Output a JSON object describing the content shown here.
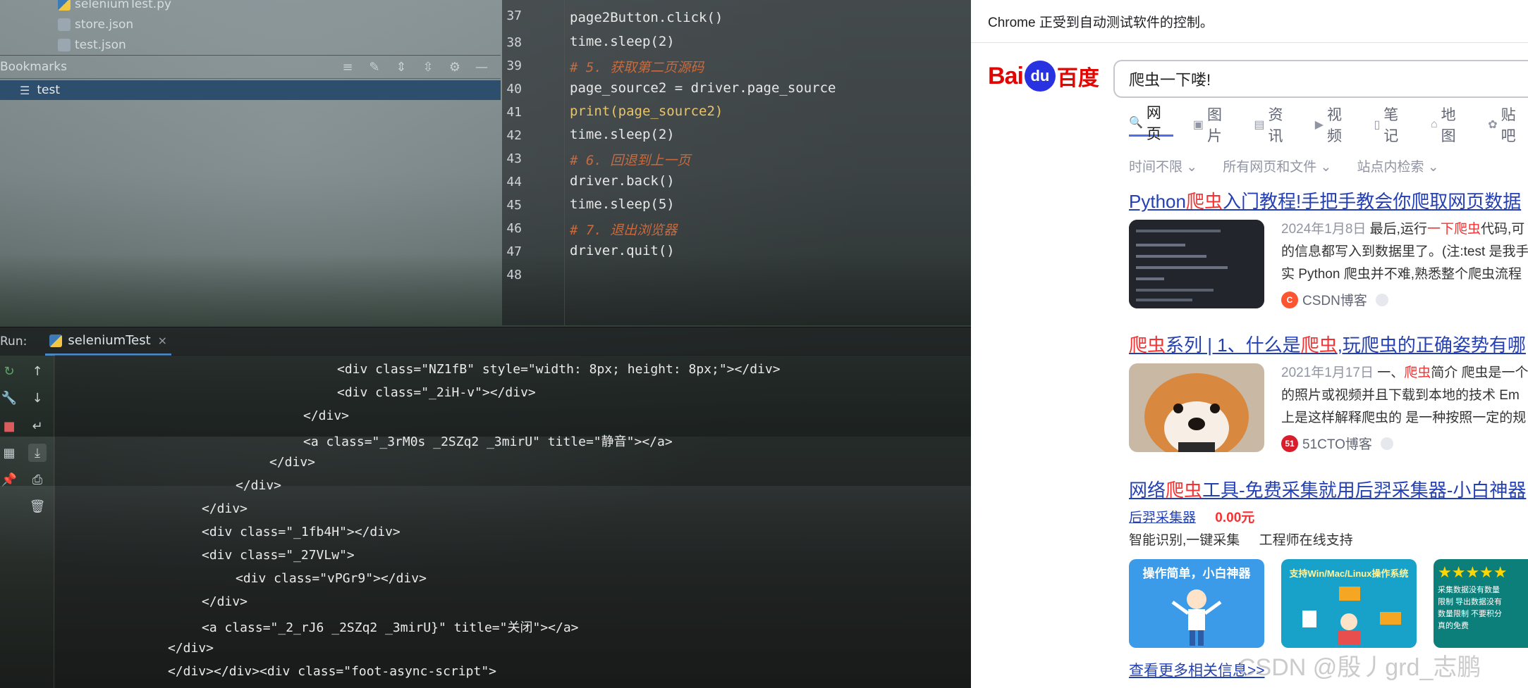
{
  "project": {
    "files": [
      {
        "name": "seleniumTest.py",
        "icon": "python-file-icon"
      },
      {
        "name": "store.json",
        "icon": "json-file-icon"
      },
      {
        "name": "test.json",
        "icon": "json-file-icon"
      }
    ]
  },
  "bookmarks": {
    "title": "Bookmarks",
    "items": [
      {
        "label": "test"
      }
    ]
  },
  "editor": {
    "lines": [
      {
        "n": "37",
        "t": "page2Button.click()"
      },
      {
        "n": "38",
        "t": "time.sleep(2)"
      },
      {
        "n": "39",
        "t": "# 5. 获取第二页源码"
      },
      {
        "n": "40",
        "t": "page_source2 = driver.page_source"
      },
      {
        "n": "41",
        "t": "print(page_source2)"
      },
      {
        "n": "42",
        "t": "time.sleep(2)"
      },
      {
        "n": "43",
        "t": "# 6. 回退到上一页"
      },
      {
        "n": "44",
        "t": "driver.back()"
      },
      {
        "n": "45",
        "t": "time.sleep(5)"
      },
      {
        "n": "46",
        "t": "# 7. 退出浏览器"
      },
      {
        "n": "47",
        "t": "driver.quit()"
      },
      {
        "n": "48",
        "t": ""
      }
    ]
  },
  "run": {
    "label": "Run:",
    "tab": "seleniumTest",
    "output": [
      "<div class=\"NZ1fB\" style=\"width: 8px; height: 8px;\"></div>",
      "<div class=\"_2iH-v\"></div>",
      "</div>",
      "<a class=\"_3rM0s _2SZq2 _3mirU\" title=\"静音\"></a>",
      "</div>",
      "</div>",
      "</div>",
      "<div class=\"_1fb4H\"></div>",
      "<div class=\"_27VLw\">",
      "<div class=\"vPGr9\"></div>",
      "</div>",
      "<a class=\"_2_rJ6 _2SZq2 _3mirU}\" title=\"关闭\"></a>",
      "</div>",
      "</div></div><div class=\"foot-async-script\">"
    ]
  },
  "browser": {
    "infobar": "Chrome 正受到自动测试软件的控制。",
    "logo": {
      "left": "Bai",
      "paw": "du",
      "right": "百度"
    },
    "query": "爬虫一下喽!",
    "tabs": [
      "网页",
      "图片",
      "资讯",
      "视频",
      "笔记",
      "地图",
      "贴吧"
    ],
    "filters": [
      "时间不限",
      "所有网页和文件",
      "站点内检索"
    ],
    "results": [
      {
        "title_pre": "Python",
        "title_hl": "爬虫",
        "title_post": "入门教程!手把手教会你爬取网页数据",
        "date": "2024年1月8日",
        "s1_pre": " 最后,运行",
        "s1_hl": "一下爬虫",
        "s1_post": "代码,可",
        "s2": "的信息都写入到数据里了。(注:test 是我手",
        "s3": "实 Python 爬虫并不难,熟悉整个爬虫流程",
        "source": "CSDN博客"
      },
      {
        "title_hl": "爬虫",
        "title_mid": "系列 | 1、什么是",
        "title_hl2": "爬虫",
        "title_post": ",玩爬虫的正确姿势有哪",
        "date": "2021年1月17日",
        "s1_pre": " 一、",
        "s1_hl": "爬虫",
        "s1_post": "简介 爬虫是一个",
        "s2": "的照片或视频并且下载到本地的技术 Em",
        "s3": "上是这样解释爬虫的 是一种按照一定的规",
        "source": "51CTO博客"
      }
    ],
    "ad": {
      "title_pre": "网络",
      "title_hl": "爬虫",
      "title_post": "工具-免费采集就用后羿采集器-小白神器",
      "advertiser": "后羿采集器",
      "price": "0.00元",
      "line2a": "智能识别,一键采集",
      "line2b": "工程师在线支持",
      "cards": [
        {
          "text": "操作简单，小白神器"
        },
        {
          "text": "支持Win/Mac/Linux操作系统"
        },
        {
          "text": "采集数据没有数量限制 导出数据没有数量限制 不要积分 真的免费"
        }
      ]
    },
    "more": "查看更多相关信息>>",
    "watermark": "CSDN @殷丿grd_志鹏"
  },
  "colors": {
    "accent": "#4e6ef2",
    "link": "#2440b3",
    "highlight": "#f73131",
    "baidu_red": "#e10602",
    "baidu_blue": "#2932e1"
  }
}
